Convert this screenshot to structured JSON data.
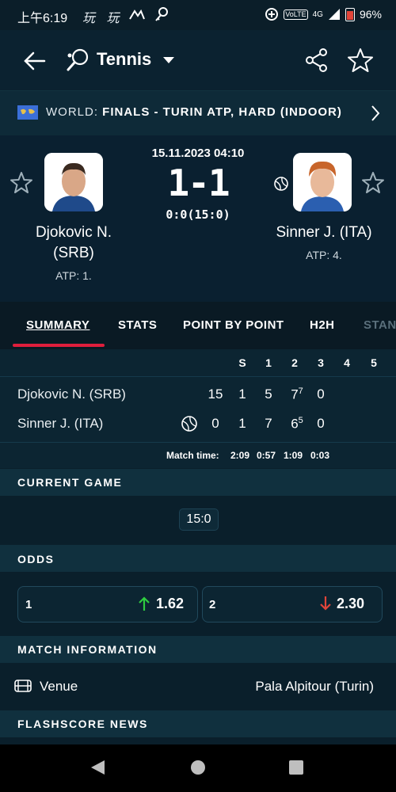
{
  "status": {
    "time": "上午6:19",
    "icons_text": "玩 玩",
    "network": "4G",
    "battery": "96%"
  },
  "app": {
    "title": "Tennis"
  },
  "tournament": {
    "prefix": "WORLD: ",
    "name": "FINALS - TURIN ATP, HARD (INDOOR)"
  },
  "match": {
    "datetime": "15.11.2023 04:10",
    "score": "1-1",
    "game": "0:0(15:0)",
    "home": {
      "name_line1": "Djokovic N.",
      "name_line2": "(SRB)",
      "rank": "ATP: 1."
    },
    "away": {
      "name_line1": "Sinner J. (ITA)",
      "rank": "ATP: 4."
    }
  },
  "tabs": [
    "SUMMARY",
    "STATS",
    "POINT BY POINT",
    "H2H",
    "STAN"
  ],
  "scoreboard": {
    "headers": [
      "S",
      "1",
      "2",
      "3",
      "4",
      "5"
    ],
    "rows": [
      {
        "name": "Djokovic N. (SRB)",
        "game": "15",
        "s": "1",
        "set1": "5",
        "set2": "7",
        "set2_tb": "7",
        "set3": "0"
      },
      {
        "name": "Sinner J. (ITA)",
        "game": "0",
        "s": "1",
        "set1": "7",
        "set2": "6",
        "set2_tb": "5",
        "set3": "0"
      }
    ],
    "match_time_label": "Match time:",
    "times": [
      "2:09",
      "0:57",
      "1:09",
      "0:03"
    ]
  },
  "current_game": {
    "heading": "CURRENT GAME",
    "score": "15:0"
  },
  "odds": {
    "heading": "ODDS",
    "home": {
      "label": "1",
      "value": "1.62",
      "direction": "up",
      "color": "#2ecc40"
    },
    "away": {
      "label": "2",
      "value": "2.30",
      "direction": "down",
      "color": "#e0453a"
    }
  },
  "match_info": {
    "heading": "MATCH INFORMATION",
    "venue_label": "Venue",
    "venue_value": "Pala Alpitour (Turin)"
  },
  "news": {
    "heading": "FLASHSCORE NEWS"
  },
  "colors": {
    "accent": "#e01e3c",
    "bg": "#0a1f2b"
  }
}
